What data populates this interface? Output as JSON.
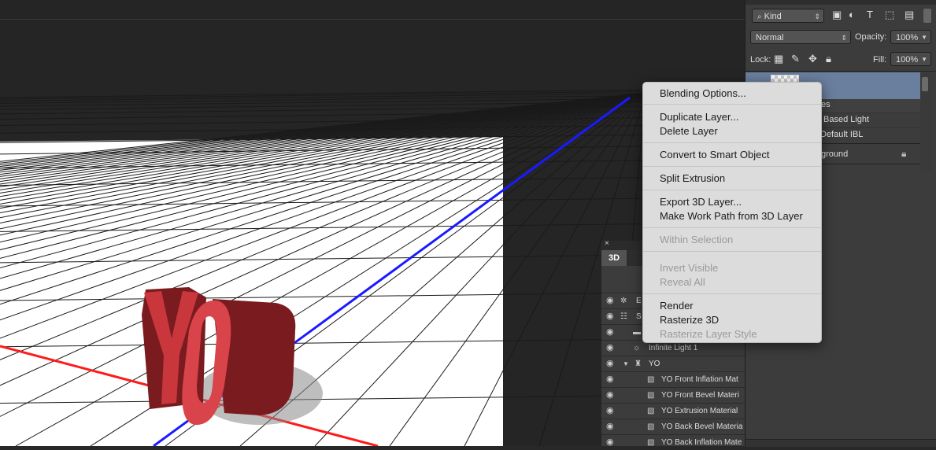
{
  "layers_panel": {
    "filter_kind": "Kind",
    "blend_mode": "Normal",
    "opacity_label": "Opacity:",
    "opacity_value": "100%",
    "lock_label": "Lock:",
    "fill_label": "Fill:",
    "fill_value": "100%",
    "partial_rows": [
      "es",
      "Based Light",
      "Default IBL",
      "ground"
    ]
  },
  "context_menu": {
    "items": [
      {
        "label": "Blending Options...",
        "enabled": true
      },
      {
        "label": "Duplicate Layer...",
        "enabled": true
      },
      {
        "label": "Delete Layer",
        "enabled": true
      },
      {
        "label": "Convert to Smart Object",
        "enabled": true
      },
      {
        "label": "Split Extrusion",
        "enabled": true
      },
      {
        "label": "Export 3D Layer...",
        "enabled": true
      },
      {
        "label": "Make Work Path from 3D Layer",
        "enabled": true
      },
      {
        "label": "Within Selection",
        "enabled": false
      },
      {
        "label": "Invert Visible",
        "enabled": false
      },
      {
        "label": "Reveal All",
        "enabled": false
      },
      {
        "label": "Render",
        "enabled": true
      },
      {
        "label": "Rasterize 3D",
        "enabled": true
      },
      {
        "label": "Rasterize Layer Style",
        "enabled": false
      }
    ]
  },
  "panel_3d": {
    "tab_label": "3D",
    "close_glyph": "×",
    "rows": [
      {
        "label": "E"
      },
      {
        "label": "S"
      },
      {
        "label": ""
      },
      {
        "label": "Infinite Light 1"
      },
      {
        "label": "YO"
      },
      {
        "label": "YO Front Inflation Mat"
      },
      {
        "label": "YO Front Bevel Materi"
      },
      {
        "label": "YO Extrusion Material"
      },
      {
        "label": "YO Back Bevel Materia"
      },
      {
        "label": "YO Back Inflation Mate"
      }
    ]
  },
  "scene": {
    "text_3d": "YO",
    "colors": {
      "text_face": "#d9434a",
      "text_side": "#7a1c1f",
      "x_axis": "#ff1a1a",
      "z_axis": "#1a1aff",
      "plane": "#ffffff",
      "grid": "#1a1a1a",
      "background": "#252525"
    }
  },
  "colors": {
    "panel_bg": "#3c3c3c",
    "selected_layer": "#6a7e9e",
    "menu_bg": "#dcdcdc"
  }
}
